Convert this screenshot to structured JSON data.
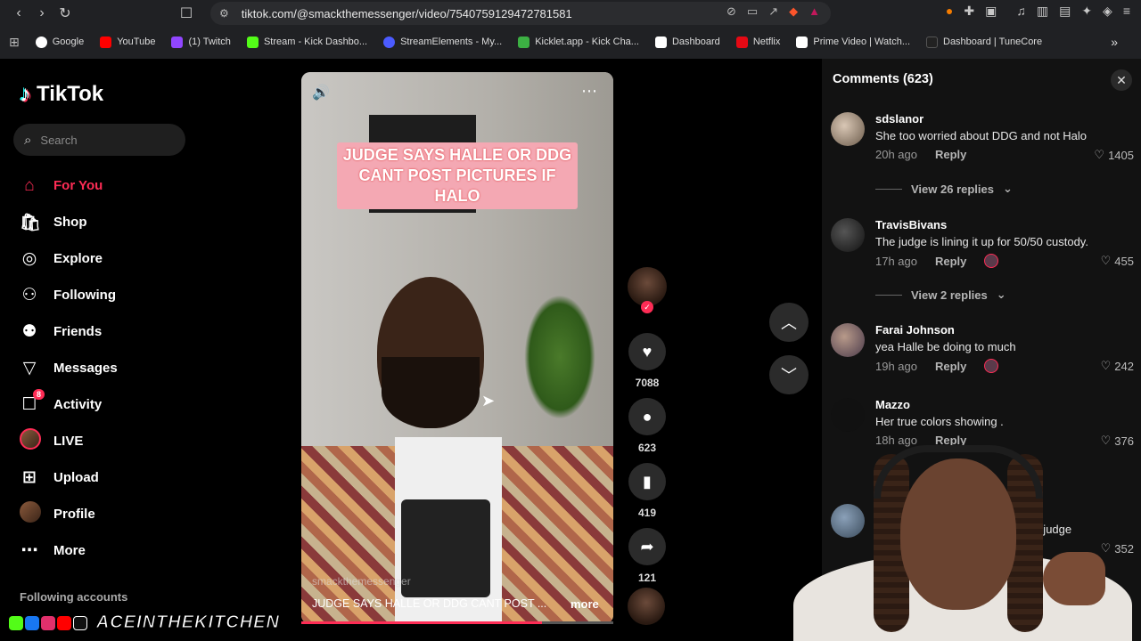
{
  "browser": {
    "url": "tiktok.com/@smackthemessenger/video/7540759129472781581",
    "bookmarks": [
      {
        "label": "Google",
        "color": "#ffffff"
      },
      {
        "label": "YouTube",
        "color": "#ff0000"
      },
      {
        "label": "(1) Twitch",
        "color": "#9146ff"
      },
      {
        "label": "Stream - Kick Dashbo...",
        "color": "#53fc18"
      },
      {
        "label": "StreamElements - My...",
        "color": "#4b5bff"
      },
      {
        "label": "Kicklet.app - Kick Cha...",
        "color": "#3cb043"
      },
      {
        "label": "Dashboard",
        "color": "#ffffff"
      },
      {
        "label": "Netflix",
        "color": "#e50914"
      },
      {
        "label": "Prime Video | Watch...",
        "color": "#ffffff"
      },
      {
        "label": "Dashboard | TuneCore",
        "color": "#222222"
      }
    ]
  },
  "sidebar": {
    "logo": "TikTok",
    "search_placeholder": "Search",
    "items": [
      {
        "label": "For You",
        "icon": "home-icon",
        "active": true
      },
      {
        "label": "Shop",
        "icon": "shop-icon"
      },
      {
        "label": "Explore",
        "icon": "compass-icon"
      },
      {
        "label": "Following",
        "icon": "following-icon"
      },
      {
        "label": "Friends",
        "icon": "friends-icon"
      },
      {
        "label": "Messages",
        "icon": "messages-icon"
      },
      {
        "label": "Activity",
        "icon": "activity-icon",
        "badge": "8"
      },
      {
        "label": "LIVE",
        "icon": "live-avatar"
      },
      {
        "label": "Upload",
        "icon": "upload-icon"
      },
      {
        "label": "Profile",
        "icon": "profile-avatar"
      },
      {
        "label": "More",
        "icon": "more-icon"
      }
    ],
    "following_accounts": "Following accounts"
  },
  "watermark": "ACEINTHEKITCHEN",
  "video": {
    "caption_lines": [
      "JUDGE SAYS HALLE OR DDG",
      "CANT POST PICTURES IF",
      "HALO"
    ],
    "username": "smackthemessenger",
    "description": "JUDGE SAYS HALLE OR DDG CANT POST ...",
    "more_label": "more",
    "progress": 0.77
  },
  "actions": {
    "likes": "7088",
    "comments": "623",
    "saves": "419",
    "shares": "121"
  },
  "comments_panel": {
    "title": "Comments (623)",
    "comments": [
      {
        "user": "sdslanor",
        "text": "She too worried about DDG and not Halo",
        "time": "20h ago",
        "reply": "Reply",
        "likes": "1405",
        "view_replies": "View 26 replies"
      },
      {
        "user": "TravisBivans",
        "text": "The judge is lining it up for 50/50 custody.",
        "time": "17h ago",
        "reply": "Reply",
        "likes": "455",
        "view_replies": "View 2 replies"
      },
      {
        "user": "Farai Johnson",
        "text": "yea Halle be doing to much",
        "time": "19h ago",
        "reply": "Reply",
        "likes": "242"
      },
      {
        "user": "Mazzo",
        "text": "Her true colors showing .",
        "time": "18h ago",
        "reply": "Reply",
        "likes": "376"
      },
      {
        "user": "",
        "text": "a new judge",
        "time": "",
        "reply": "",
        "likes": "352"
      }
    ]
  }
}
